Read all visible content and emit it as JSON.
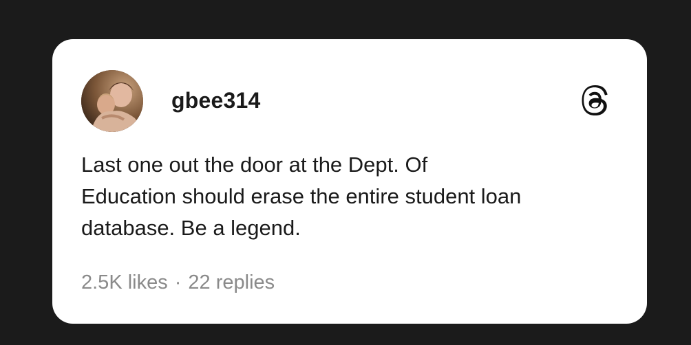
{
  "post": {
    "username": "gbee314",
    "text_lines": [
      "Last one out the door at the Dept. Of",
      "Education should erase the entire student loan",
      "database. Be a legend."
    ],
    "likes": "2.5K likes",
    "separator": "·",
    "replies": "22 replies",
    "avatar_icon": "user-avatar-photo",
    "brand_icon": "threads-logo-icon"
  },
  "colors": {
    "background": "#1b1b1b",
    "card": "#ffffff",
    "text": "#1a1a1a",
    "muted": "#8a8a8a"
  }
}
